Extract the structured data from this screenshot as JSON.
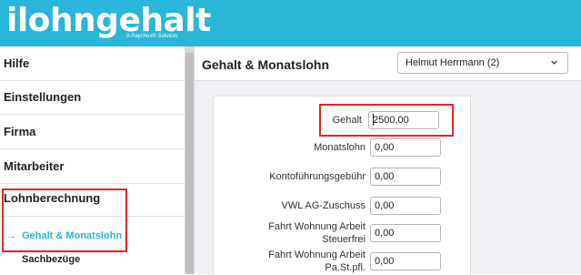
{
  "header": {
    "logo_text": "ilohngehalt",
    "logo_subtitle": "A Paychex® Solution",
    "background_color": "#29b6d9"
  },
  "sidebar": {
    "items": [
      {
        "label": "Hilfe"
      },
      {
        "label": "Einstellungen"
      },
      {
        "label": "Firma"
      },
      {
        "label": "Mitarbeiter"
      },
      {
        "label": "Lohnberechnung"
      }
    ],
    "active_subitem": {
      "arrow": "→",
      "label": "Gehalt & Monatslohn",
      "color": "#29b6d9"
    },
    "next_subitem": {
      "label": "Sachbezüge"
    }
  },
  "main": {
    "title": "Gehalt & Monatslohn",
    "employee_select": {
      "value": "Helmut Herrmann (2)",
      "icon": "chevron-down-icon"
    }
  },
  "form": {
    "fields": [
      {
        "label": "Gehalt",
        "value": "2500,00"
      },
      {
        "label": "Monatslohn",
        "value": "0,00"
      },
      {
        "label": "Kontoführungsgebühr",
        "value": "0,00"
      },
      {
        "label": "VWL AG-Zuschuss",
        "value": "0,00"
      },
      {
        "label_lines": [
          "Fahrt Wohnung Arbeit",
          "Steuerfrei"
        ],
        "value": "0,00"
      },
      {
        "label_lines": [
          "Fahrt Wohnung Arbeit",
          "Pa.St.pfl."
        ],
        "value": "0,00"
      }
    ]
  },
  "highlight_color": "#e32626"
}
